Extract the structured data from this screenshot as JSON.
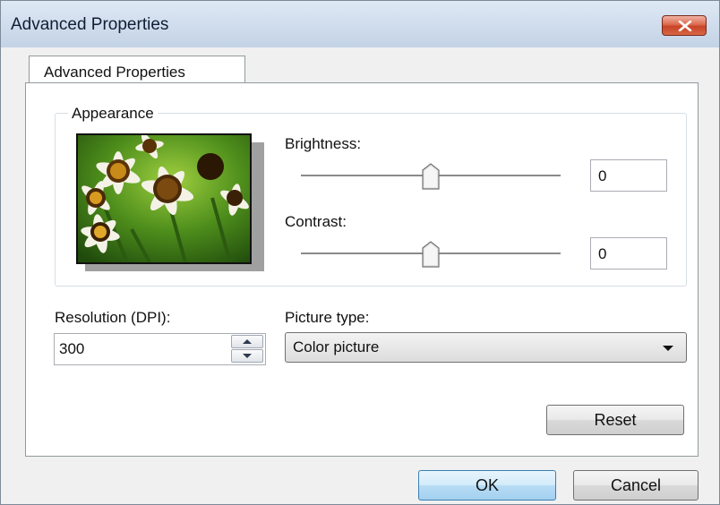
{
  "window": {
    "title": "Advanced Properties",
    "close_icon": "close-x-icon"
  },
  "tabs": [
    {
      "label": "Advanced Properties",
      "selected": true
    }
  ],
  "appearance": {
    "group_label": "Appearance",
    "preview": {
      "image": "daisy-flowers-photo"
    },
    "brightness": {
      "label": "Brightness:",
      "value": "0"
    },
    "contrast": {
      "label": "Contrast:",
      "value": "0"
    }
  },
  "resolution": {
    "label": "Resolution (DPI):",
    "value": "300"
  },
  "picture_type": {
    "label": "Picture type:",
    "value": "Color picture"
  },
  "buttons": {
    "reset": "Reset",
    "ok": "OK",
    "cancel": "Cancel"
  },
  "colors": {
    "titlebar": "#cfdcec",
    "close_button": "#c84326",
    "default_button": "#b7dcf5"
  }
}
